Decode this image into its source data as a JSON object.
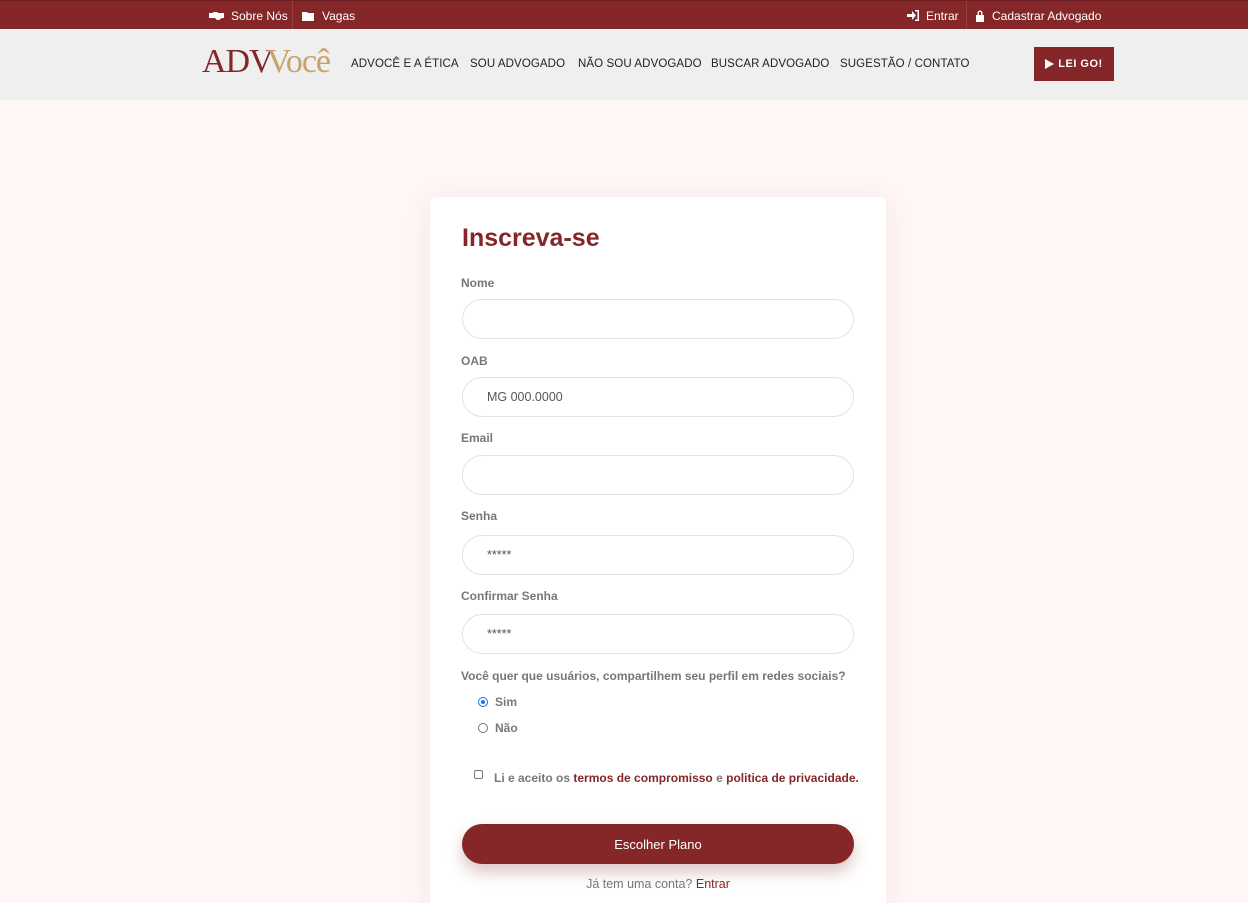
{
  "topbar": {
    "about": "Sobre Nós",
    "jobs": "Vagas",
    "login": "Entrar",
    "register": "Cadastrar Advogado"
  },
  "logo": {
    "part1": "ADV",
    "part2": "ocê"
  },
  "nav": {
    "items": [
      "ADVOCÊ E A ÉTICA",
      "SOU ADVOGADO",
      "NÃO SOU ADVOGADO",
      "BUSCAR ADVOGADO",
      "SUGESTÃO / CONTATO"
    ],
    "cta": "LEI GO!"
  },
  "form": {
    "title": "Inscreva-se",
    "name_label": "Nome",
    "name_value": "",
    "oab_label": "OAB",
    "oab_placeholder": "MG 000.0000",
    "email_label": "Email",
    "email_value": "",
    "password_label": "Senha",
    "password_placeholder": "*****",
    "confirm_label": "Confirmar Senha",
    "confirm_placeholder": "*****",
    "share_question": "Você quer que usuários, compartilhem seu perfil em redes sociais?",
    "option_yes": "Sim",
    "option_no": "Não",
    "selected": "Sim",
    "terms_prefix": "Li e aceito os",
    "terms_link": "termos de compromisso",
    "terms_and": "e",
    "privacy_link": "politica de privacidade",
    "terms_suffix": ".",
    "terms_checked": false,
    "submit": "Escolher Plano",
    "has_account": "Já tem uma conta?",
    "login_link": "Entrar"
  },
  "colors": {
    "brand": "#852628",
    "gold": "#c9a26a",
    "background": "#fff6f6"
  }
}
